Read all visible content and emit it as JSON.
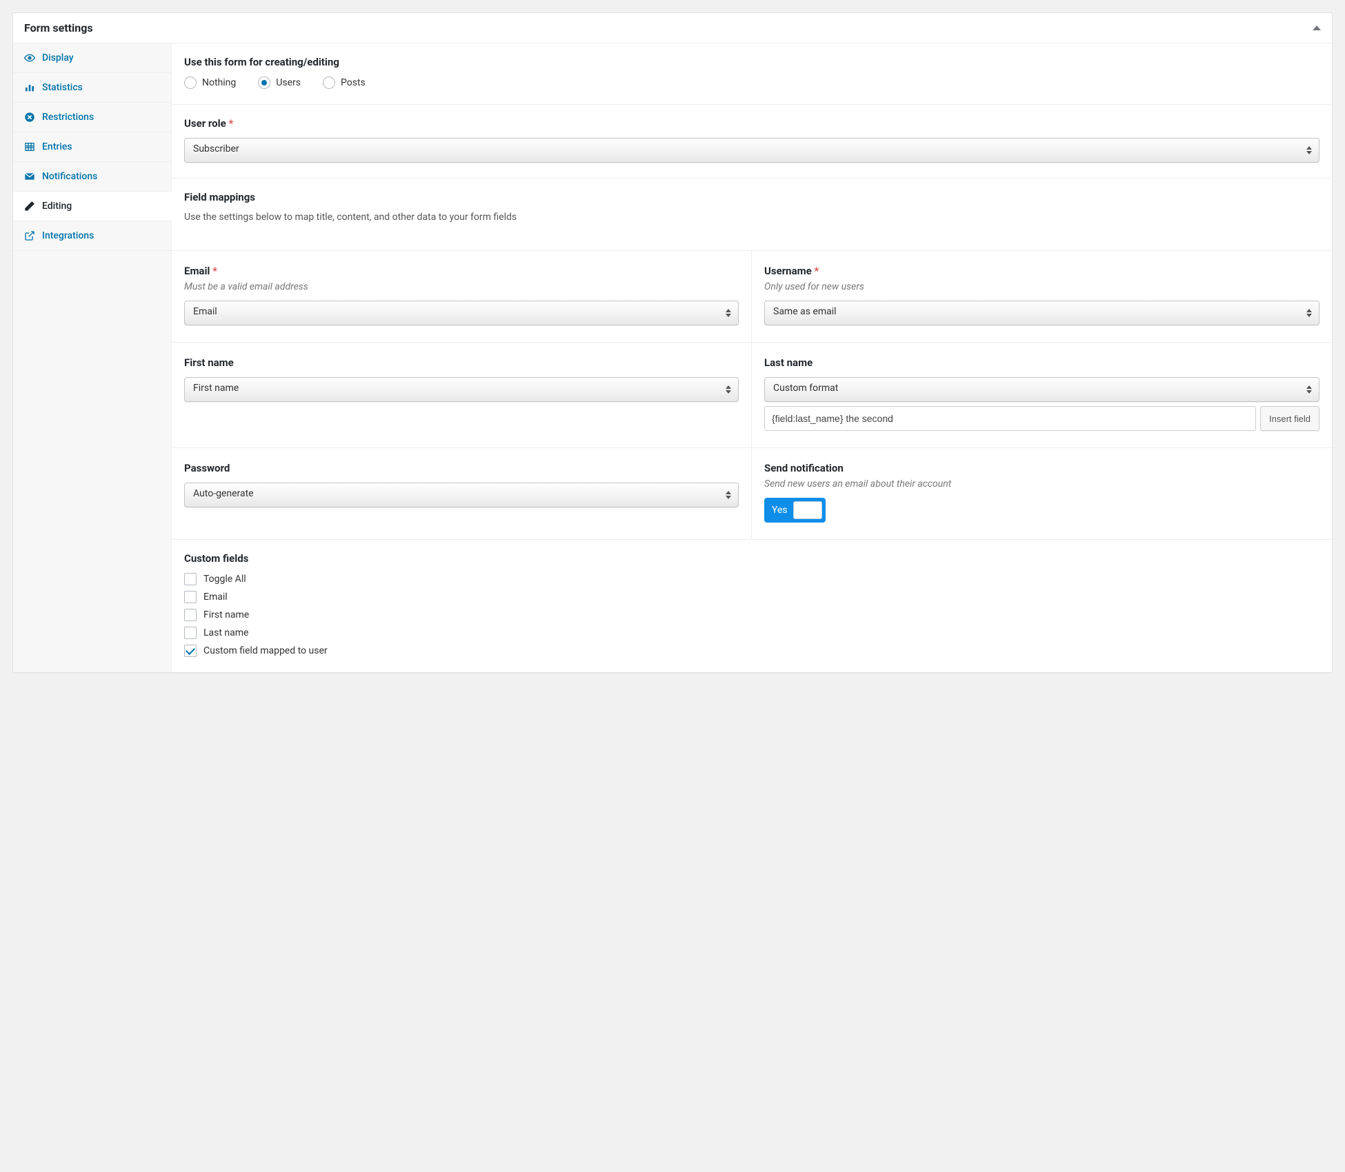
{
  "panel": {
    "title": "Form settings"
  },
  "sidebar": {
    "items": [
      {
        "key": "display",
        "label": "Display"
      },
      {
        "key": "statistics",
        "label": "Statistics"
      },
      {
        "key": "restrictions",
        "label": "Restrictions"
      },
      {
        "key": "entries",
        "label": "Entries"
      },
      {
        "key": "notifications",
        "label": "Notifications"
      },
      {
        "key": "editing",
        "label": "Editing"
      },
      {
        "key": "integrations",
        "label": "Integrations"
      }
    ],
    "active": "editing"
  },
  "editing": {
    "useForm": {
      "label": "Use this form for creating/editing",
      "options": [
        "Nothing",
        "Users",
        "Posts"
      ],
      "selected": "Users"
    },
    "userRole": {
      "label": "User role",
      "required": true,
      "value": "Subscriber"
    },
    "fieldMappings": {
      "heading": "Field mappings",
      "description": "Use the settings below to map title, content, and other data to your form fields"
    },
    "email": {
      "label": "Email",
      "required": true,
      "hint": "Must be a valid email address",
      "value": "Email"
    },
    "username": {
      "label": "Username",
      "required": true,
      "hint": "Only used for new users",
      "value": "Same as email"
    },
    "firstName": {
      "label": "First name",
      "value": "First name"
    },
    "lastName": {
      "label": "Last name",
      "value": "Custom format",
      "custom": "{field:last_name} the second",
      "insertBtn": "Insert field"
    },
    "password": {
      "label": "Password",
      "value": "Auto-generate"
    },
    "sendNotification": {
      "label": "Send notification",
      "hint": "Send new users an email about their account",
      "value": "Yes"
    },
    "customFields": {
      "label": "Custom fields",
      "options": [
        {
          "label": "Toggle All",
          "checked": false
        },
        {
          "label": "Email",
          "checked": false
        },
        {
          "label": "First name",
          "checked": false
        },
        {
          "label": "Last name",
          "checked": false
        },
        {
          "label": "Custom field mapped to user",
          "checked": true
        }
      ]
    }
  }
}
